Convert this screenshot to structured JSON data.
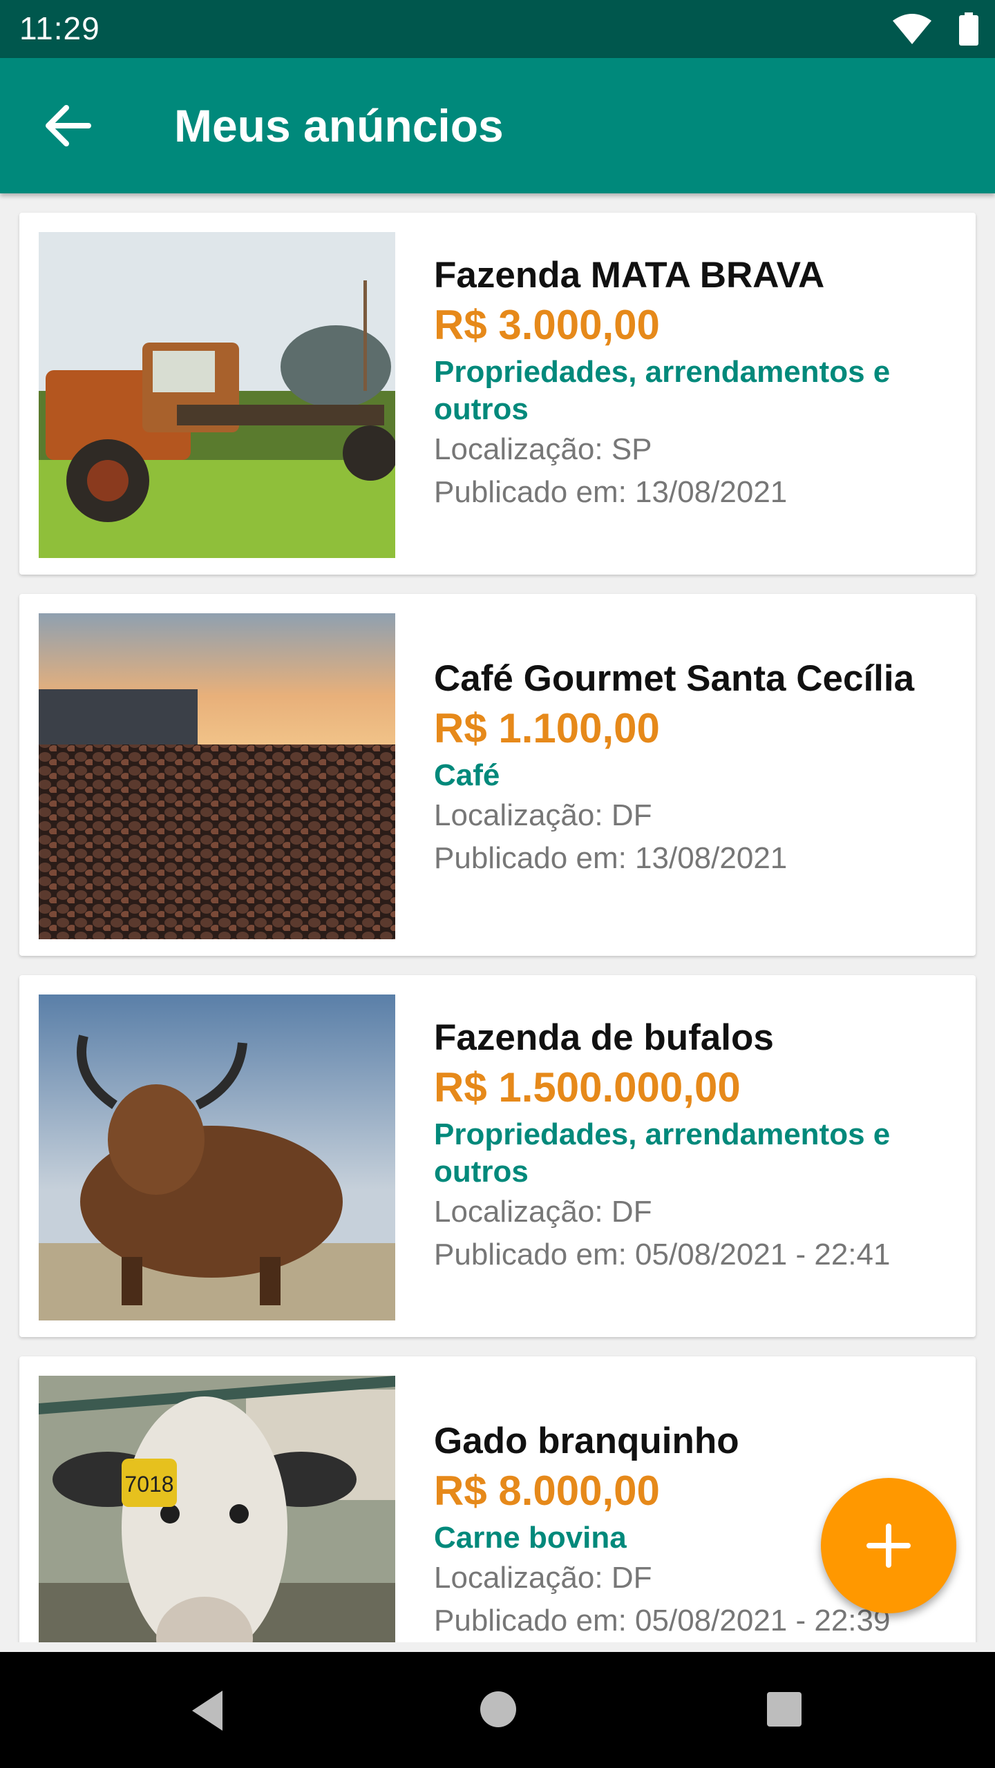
{
  "status": {
    "time": "11:29",
    "icons": [
      "wifi-icon",
      "battery-icon"
    ]
  },
  "appbar": {
    "title": "Meus anúncios",
    "back_icon": "arrow-back-icon"
  },
  "colors": {
    "primary": "#00897b",
    "primary_dark": "#00574d",
    "price": "#e6891a",
    "fab": "#ff9800"
  },
  "listings": [
    {
      "name": "Fazenda MATA BRAVA",
      "price": "R$ 3.000,00",
      "category": "Propriedades, arrendamentos e outros",
      "location": "Localização: SP",
      "published": "Publicado em: 13/08/2021",
      "image": "old-rusty-truck-photo"
    },
    {
      "name": "Café Gourmet Santa Cecília",
      "price": "R$ 1.100,00",
      "category": "Café",
      "location": "Localização: DF",
      "published": "Publicado em: 13/08/2021",
      "image": "coffee-beans-photo"
    },
    {
      "name": "Fazenda de bufalos",
      "price": "R$ 1.500.000,00",
      "category": "Propriedades, arrendamentos e outros",
      "location": "Localização: DF",
      "published": "Publicado em: 05/08/2021 - 22:41",
      "image": "highland-bull-photo"
    },
    {
      "name": "Gado branquinho",
      "price": "R$ 8.000,00",
      "category": "Carne bovina",
      "location": "Localização: DF",
      "published": "Publicado em: 05/08/2021 - 22:39",
      "image": "white-calf-photo",
      "ear_tag": "7018"
    }
  ],
  "fab": {
    "icon": "plus-icon"
  },
  "navbar": {
    "icons": [
      "back-triangle-icon",
      "home-circle-icon",
      "recents-square-icon"
    ]
  }
}
